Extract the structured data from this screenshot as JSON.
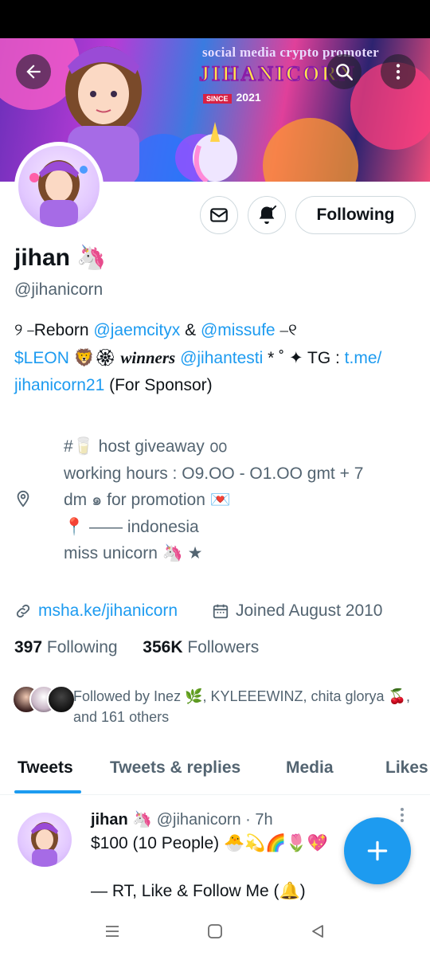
{
  "banner": {
    "tagline": "social media crypto promoter",
    "brand": "JIHANICORN",
    "since_badge": "SINCE",
    "since_year": "2021"
  },
  "profile": {
    "name": "jihan 🦄",
    "handle": "@jihanicorn",
    "follow_state_label": "Following",
    "bio": {
      "line1_prefix": "୨ ⎯Reborn ",
      "mention1": "@jaemcityx",
      "amp": " & ",
      "mention2": "@missufe",
      "line1_suffix": " ⎯୧",
      "cashtag": "$LEON",
      "mid": " 🦁🏵 ",
      "winners": "winners",
      "space": " ",
      "mention3": "@jihantesti",
      "after_mention3": " * ˚ ✦ TG : ",
      "tg_link_part1": "t.me/",
      "tg_link_part2": "jihanicorn21",
      "sponsor": " (For Sponsor)"
    },
    "location_lines": [
      "#🥛  host  giveaway  ൦൦",
      "working hours : O9.OO - O1.OO gmt + 7",
      "dm  ๑  for  promotion  💌",
      "📍 —— indonesia",
      "miss  unicorn  🦄 ★"
    ],
    "website": "msha.ke/jihanicorn",
    "joined": "Joined August 2010",
    "following_count": "397",
    "following_label": "Following",
    "followers_count": "356K",
    "followers_label": "Followers",
    "followed_by": "Followed by Inez 🌿, KYLEEEWINZ, chita glorya 🍒, and 161 others"
  },
  "tabs": [
    {
      "label": "Tweets",
      "active": true
    },
    {
      "label": "Tweets & replies",
      "active": false
    },
    {
      "label": "Media",
      "active": false
    },
    {
      "label": "Likes",
      "active": false
    }
  ],
  "tweet": {
    "name": "jihan 🦄",
    "handle_time": "@jihanicorn · 7h",
    "line1": "$100 (10 People) 🐣💫🌈🌷💖",
    "line2": "— RT, Like & Follow Me (🔔)"
  },
  "colors": {
    "accent": "#1d9bf0",
    "text": "#0f1419",
    "muted": "#536471"
  },
  "icons": [
    "back-arrow-icon",
    "search-icon",
    "more-vertical-icon",
    "mail-icon",
    "notification-bell-icon",
    "location-pin-icon",
    "link-icon",
    "calendar-icon",
    "plus-icon",
    "recents-nav-icon",
    "home-nav-icon",
    "back-nav-icon"
  ]
}
